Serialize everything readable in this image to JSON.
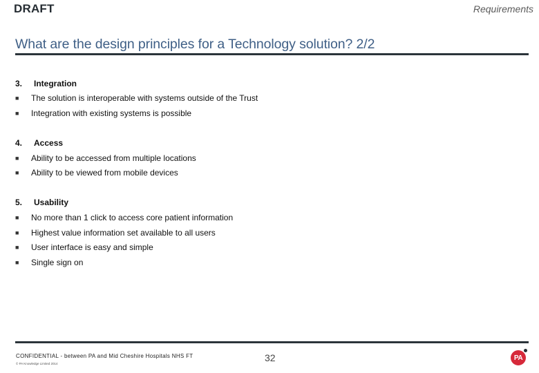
{
  "header": {
    "draft_label": "DRAFT",
    "section_label": "Requirements"
  },
  "title": "What are the design principles for a Technology solution? 2/2",
  "sections": [
    {
      "number": "3.",
      "heading": "Integration",
      "bullets": [
        "The solution is interoperable with systems outside of the Trust",
        "Integration with existing systems is possible"
      ]
    },
    {
      "number": "4.",
      "heading": "Access",
      "bullets": [
        "Ability to be accessed from multiple locations",
        "Ability to be viewed from mobile devices"
      ]
    },
    {
      "number": "5.",
      "heading": "Usability",
      "bullets": [
        "No more than 1 click to access core patient information",
        "Highest value information set available to all users",
        "User interface is easy and simple",
        "Single sign on"
      ]
    }
  ],
  "bullet_glyph": "■",
  "footer": {
    "confidential": "CONFIDENTIAL - between PA and Mid Cheshire Hospitals NHS FT",
    "copyright": "© PA Knowledge Limited 2014",
    "page_number": "32",
    "logo_text": "PA"
  },
  "colors": {
    "title": "#3f5f86",
    "rule": "#2b343a",
    "logo": "#d6293a"
  }
}
